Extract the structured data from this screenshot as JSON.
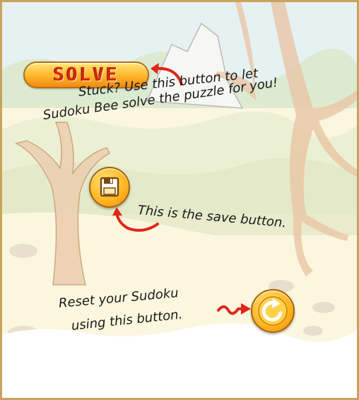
{
  "buttons": {
    "solve_label": "SOLVE"
  },
  "help": {
    "solve_line1": "Stuck? Use this button to let",
    "solve_line2": "Sudoku Bee solve the puzzle for you!",
    "save_text": "This is the save button.",
    "reset_line1": "Reset your Sudoku",
    "reset_line2": "using this button."
  },
  "colors": {
    "button_gold": "#ffb21f",
    "solve_text": "#d42a10",
    "arrow_red": "#e0261b",
    "frame": "#c9a35c"
  },
  "icons": {
    "save": "floppy-disk-icon",
    "reset": "circular-arrow-icon"
  }
}
